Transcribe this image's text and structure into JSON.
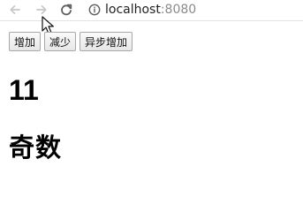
{
  "browser": {
    "url_host": "localhost",
    "url_port": ":8080",
    "icons": {
      "back": "back-arrow-icon",
      "forward": "forward-arrow-icon",
      "reload": "reload-icon",
      "info": "info-icon",
      "cursor": "mouse-cursor-icon"
    }
  },
  "toolbar": {
    "increment_label": "增加",
    "decrement_label": "减少",
    "async_increment_label": "异步增加"
  },
  "counter": {
    "value": "11",
    "parity": "奇数"
  },
  "colors": {
    "url_port": "#8a8a8a",
    "button_border": "#a8a8a8"
  }
}
